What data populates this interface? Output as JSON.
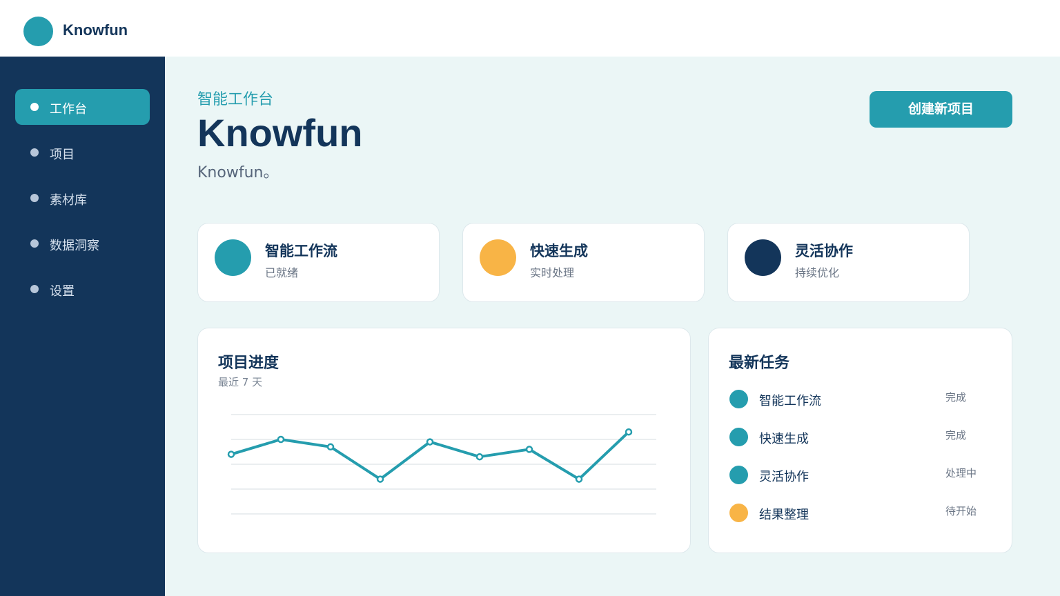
{
  "brand": {
    "name": "Knowfun"
  },
  "sidebar": {
    "items": [
      {
        "label": "工作台",
        "active": true
      },
      {
        "label": "项目"
      },
      {
        "label": "素材库"
      },
      {
        "label": "数据洞察"
      },
      {
        "label": "设置"
      }
    ]
  },
  "header": {
    "eyebrow": "智能工作台",
    "title": "Knowfun",
    "subtitle": "Knowfun。",
    "create_button": "创建新项目"
  },
  "features": [
    {
      "title": "智能工作流",
      "status": "已就绪",
      "color": "#259dae"
    },
    {
      "title": "快速生成",
      "status": "实时处理",
      "color": "#f8b446"
    },
    {
      "title": "灵活协作",
      "status": "持续优化",
      "color": "#13355a"
    }
  ],
  "progress": {
    "title": "项目进度",
    "subtitle": "最近 7 天"
  },
  "chart_data": {
    "type": "line",
    "x": [
      1,
      2,
      3,
      4,
      5,
      6,
      7,
      8,
      9
    ],
    "series": [
      {
        "values": [
          64,
          70,
          67,
          54,
          69,
          63,
          66,
          54,
          73
        ]
      }
    ],
    "ylim": [
      40,
      80
    ],
    "grid": true,
    "color": "#259dae"
  },
  "tasks": {
    "title": "最新任务",
    "items": [
      {
        "name": "智能工作流",
        "status": "完成",
        "color": "#259dae"
      },
      {
        "name": "快速生成",
        "status": "完成",
        "color": "#259dae"
      },
      {
        "name": "灵活协作",
        "status": "处理中",
        "color": "#259dae"
      },
      {
        "name": "结果整理",
        "status": "待开始",
        "color": "#f8b446"
      }
    ]
  }
}
